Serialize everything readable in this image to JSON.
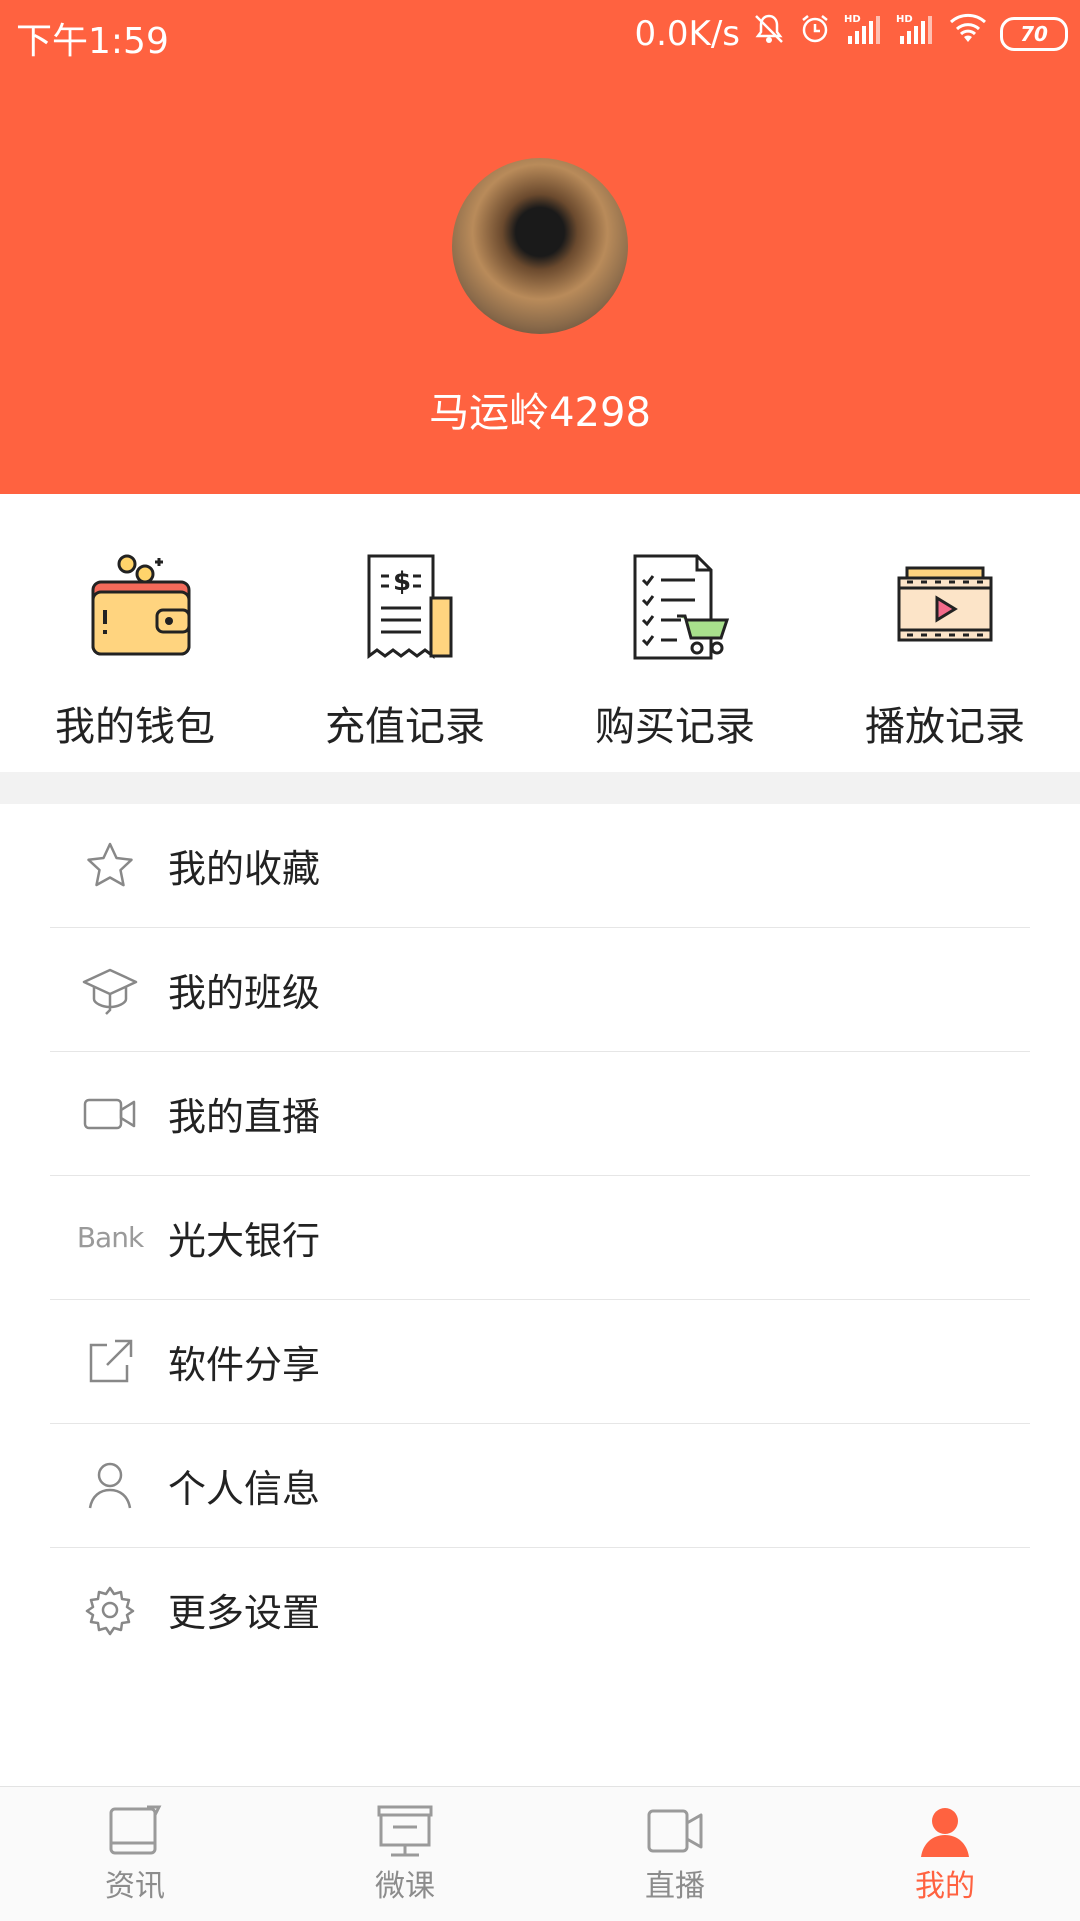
{
  "status_bar": {
    "time": "下午1:59",
    "network_speed": "0.0K/s",
    "battery": "70",
    "signal_label_1": "HD",
    "signal_label_2": "HD"
  },
  "profile": {
    "username": "马运岭4298"
  },
  "quick_actions": [
    {
      "label": "我的钱包",
      "icon": "wallet-icon"
    },
    {
      "label": "充值记录",
      "icon": "receipt-icon"
    },
    {
      "label": "购买记录",
      "icon": "purchase-list-icon"
    },
    {
      "label": "播放记录",
      "icon": "video-play-icon"
    }
  ],
  "menu": [
    {
      "label": "我的收藏",
      "icon": "star-icon"
    },
    {
      "label": "我的班级",
      "icon": "graduation-cap-icon"
    },
    {
      "label": "我的直播",
      "icon": "video-camera-icon"
    },
    {
      "label": "光大银行",
      "icon": "bank-icon",
      "icon_text": "Bank"
    },
    {
      "label": "软件分享",
      "icon": "share-icon"
    },
    {
      "label": "个人信息",
      "icon": "person-icon"
    },
    {
      "label": "更多设置",
      "icon": "gear-icon"
    }
  ],
  "tabs": [
    {
      "label": "资讯",
      "icon": "news-icon",
      "active": false
    },
    {
      "label": "微课",
      "icon": "microclass-icon",
      "active": false
    },
    {
      "label": "直播",
      "icon": "live-icon",
      "active": false
    },
    {
      "label": "我的",
      "icon": "profile-icon",
      "active": true
    }
  ],
  "colors": {
    "accent": "#FF6240",
    "tab_inactive": "#8c8c8c",
    "divider": "#f2f2f2"
  }
}
